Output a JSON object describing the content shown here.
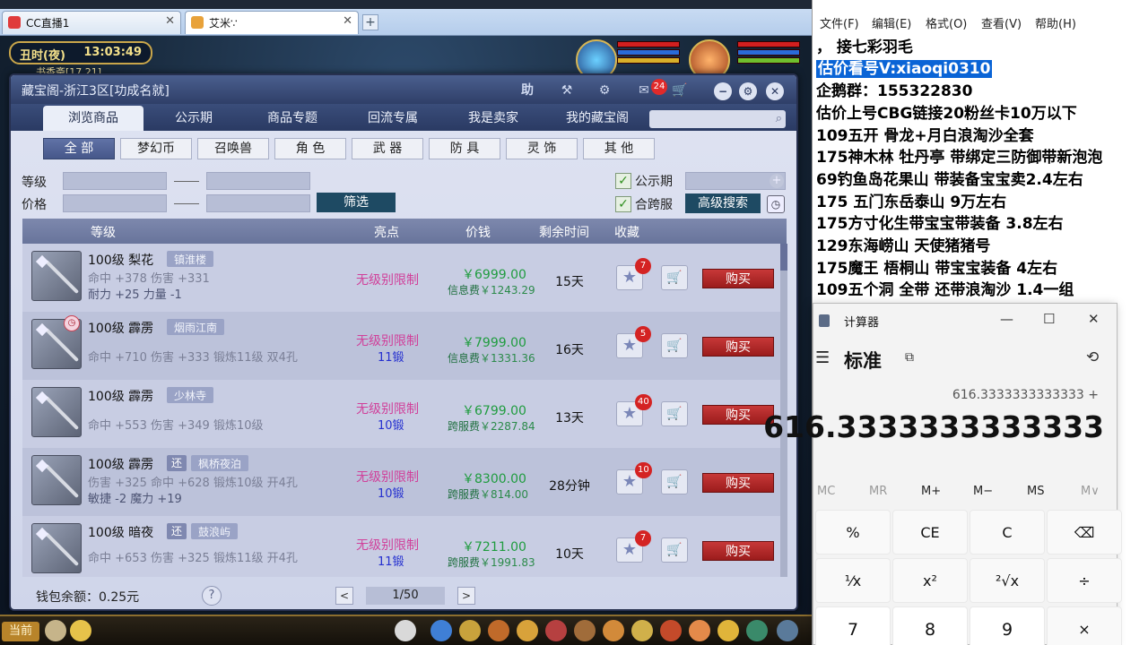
{
  "browser": {
    "tabs": [
      {
        "label": "CC直播1"
      },
      {
        "label": "艾米∵"
      }
    ]
  },
  "game": {
    "clock_period": "丑时(夜)",
    "clock_time": "13:03:49",
    "location": "书香斋[17,21]",
    "current_chat": "当前"
  },
  "dialog": {
    "title": "藏宝阁-浙江3区[功成名就]",
    "help_label": "助",
    "message_count": "24",
    "nav_tabs": [
      "浏览商品",
      "公示期",
      "商品专题",
      "回流专属",
      "我是卖家",
      "我的藏宝阁"
    ],
    "categories": [
      "全 部",
      "梦幻币",
      "召唤兽",
      "角 色",
      "武 器",
      "防 具",
      "灵 饰",
      "其 他"
    ],
    "filter": {
      "level_label": "等级",
      "price_label": "价格",
      "filter_button": "筛选",
      "gongshi_label": "公示期",
      "cross_label": "合跨服",
      "advanced_button": "高级搜索"
    },
    "table_headers": {
      "level": "等级",
      "highlight": "亮点",
      "price": "价钱",
      "remaining": "剩余时间",
      "favorite": "收藏"
    },
    "rows": [
      {
        "name": "100级 梨花",
        "tag": "镇淮楼",
        "stat1": "命中 +378 伤害 +331",
        "stat2": "耐力 +25 力量 -1",
        "highlight": "无级别限制",
        "forge": "",
        "price": "￥6999.00",
        "fee_label": "信息费",
        "fee_value": "￥1243.29",
        "remaining": "15天",
        "fav_count": "7",
        "buy": "购买"
      },
      {
        "name": "100级 霹雳",
        "tag": "烟雨江南",
        "stat1": "命中 +710 伤害 +333 锻炼11级 双4孔",
        "stat2": "",
        "highlight": "无级别限制",
        "forge": "11锻",
        "price": "￥7999.00",
        "fee_label": "信息费",
        "fee_value": "￥1331.36",
        "remaining": "16天",
        "fav_count": "5",
        "buy": "购买"
      },
      {
        "name": "100级 霹雳",
        "tag": "少林寺",
        "stat1": "命中 +553 伤害 +349 锻炼10级",
        "stat2": "",
        "highlight": "无级别限制",
        "forge": "10锻",
        "price": "￥6799.00",
        "fee_label": "跨服费",
        "fee_value": "￥2287.84",
        "remaining": "13天",
        "fav_count": "40",
        "buy": "购买"
      },
      {
        "name": "100级 霹雳",
        "tag_small": "还",
        "tag": "枫桥夜泊",
        "stat1": "伤害 +325 命中 +628 锻炼10级 开4孔",
        "stat2": "敏捷 -2 魔力 +19",
        "highlight": "无级别限制",
        "forge": "10锻",
        "price": "￥8300.00",
        "fee_label": "跨服费",
        "fee_value": "￥814.00",
        "remaining": "28分钟",
        "fav_count": "10",
        "buy": "购买"
      },
      {
        "name": "100级 暗夜",
        "tag_small": "还",
        "tag": "鼓浪屿",
        "stat1": "命中 +653 伤害 +325 锻炼11级 开4孔",
        "stat2": "",
        "highlight": "无级别限制",
        "forge": "11锻",
        "price": "￥7211.00",
        "fee_label": "跨服费",
        "fee_value": "￥1991.83",
        "remaining": "10天",
        "fav_count": "7",
        "buy": "购买"
      }
    ],
    "wallet": "钱包余额：0.25元",
    "help": "?",
    "page": "1/50",
    "prev": "<",
    "next": ">"
  },
  "notepad": {
    "menu": [
      "文件(F)",
      "编辑(E)",
      "格式(O)",
      "查看(V)",
      "帮助(H)"
    ],
    "lines": [
      "，    接七彩羽毛",
      "估价看号V:xiaoqi0310",
      "企鹅群：155322830",
      "估价上号CBG链接20粉丝卡10万以下",
      "109五开 骨龙+月白浪淘沙全套",
      "175神木林 牡丹亭  带绑定三防御带新泡泡",
      "69钓鱼岛花果山 带装备宝宝卖2.4左右",
      "175 五门东岳泰山  9万左右",
      "175方寸化生带宝宝带装备  3.8左右",
      "129东海崂山 天使猪猪号",
      "175魔王 梧桐山  带宝宝装备 4左右",
      "109五个洞 全带 还带浪淘沙  1.4一组"
    ]
  },
  "calculator": {
    "title": "计算器",
    "mode": "标准",
    "expression": "616.3333333333333 +",
    "display": "616.3333333333333",
    "memory": [
      "MC",
      "MR",
      "M+",
      "M−",
      "MS",
      "M∨"
    ],
    "keys_row1": [
      "%",
      "CE",
      "C",
      "⌫"
    ],
    "keys_row2": [
      "¹⁄x",
      "x²",
      "²√x",
      "÷"
    ],
    "keys_row3": [
      "7",
      "8",
      "9",
      "×"
    ]
  }
}
